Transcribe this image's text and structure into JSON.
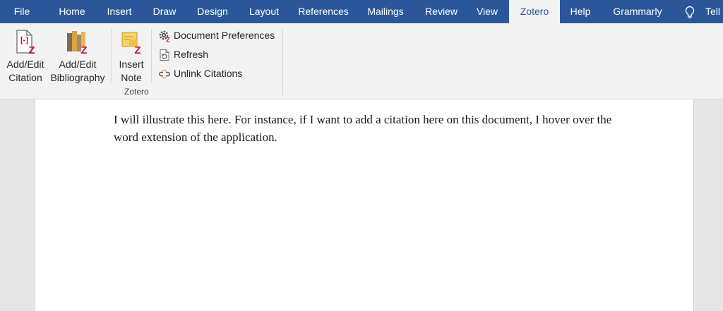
{
  "tabs": [
    {
      "label": "File"
    },
    {
      "label": "Home"
    },
    {
      "label": "Insert"
    },
    {
      "label": "Draw"
    },
    {
      "label": "Design"
    },
    {
      "label": "Layout"
    },
    {
      "label": "References"
    },
    {
      "label": "Mailings"
    },
    {
      "label": "Review"
    },
    {
      "label": "View"
    },
    {
      "label": "Zotero",
      "active": true
    },
    {
      "label": "Help"
    },
    {
      "label": "Grammarly"
    },
    {
      "label": "Tell"
    }
  ],
  "ribbon": {
    "add_edit_citation": {
      "line1": "Add/Edit",
      "line2": "Citation",
      "icon": "add-edit-citation-icon"
    },
    "add_edit_bibliography": {
      "line1": "Add/Edit",
      "line2": "Bibliography",
      "icon": "bibliography-icon"
    },
    "insert_note": {
      "line1": "Insert",
      "line2": "Note",
      "icon": "insert-note-icon"
    },
    "document_preferences": {
      "label": "Document Preferences",
      "icon": "gear-icon"
    },
    "refresh": {
      "label": "Refresh",
      "icon": "refresh-icon"
    },
    "unlink_citations": {
      "label": "Unlink Citations",
      "icon": "unlink-icon"
    },
    "group_label": "Zotero"
  },
  "document": {
    "paragraph": "I will illustrate this here. For instance, if I want to add a citation here on this document, I hover over the word extension of the application."
  },
  "colors": {
    "ribbon_tab_bar": "#2b579a",
    "zotero_red": "#c8102e"
  }
}
